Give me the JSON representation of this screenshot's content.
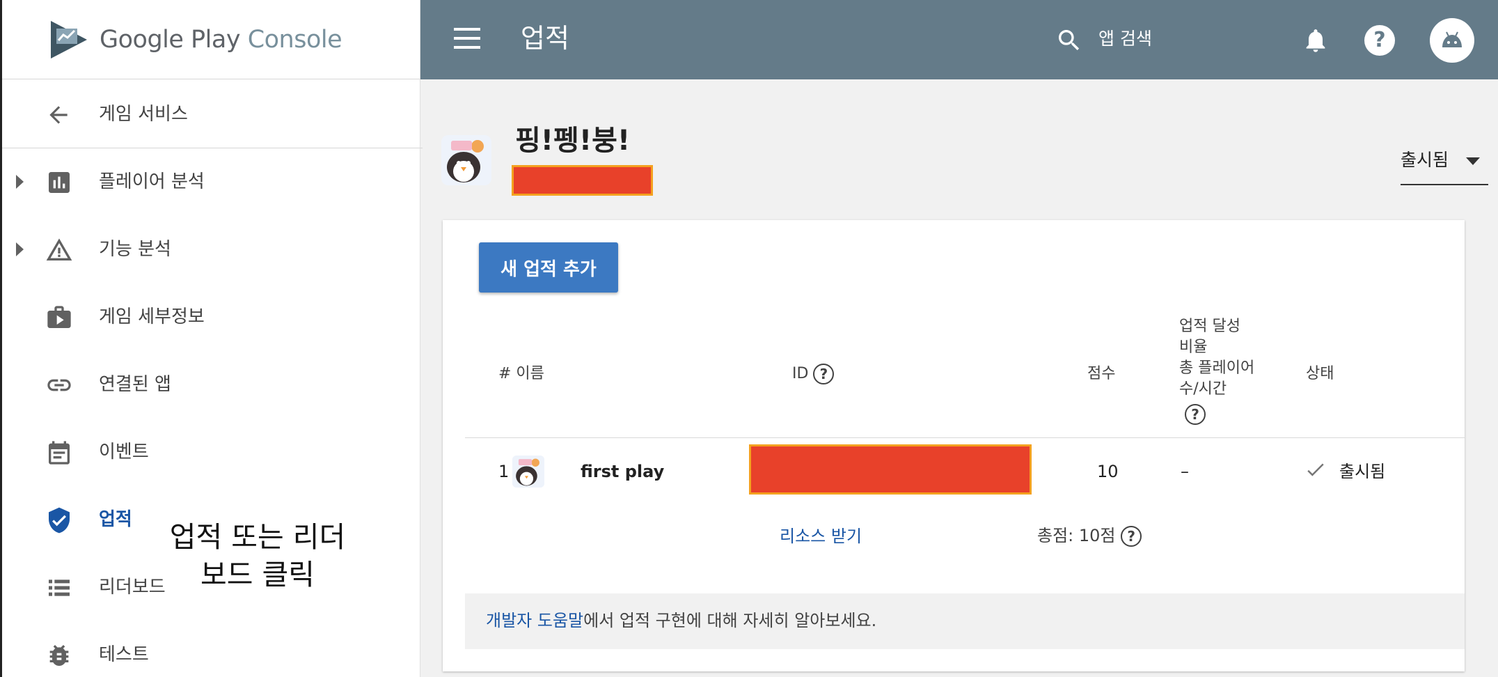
{
  "app": {
    "brand_google_play": "Google Play",
    "brand_console": "Console"
  },
  "sidebar": {
    "back_label": "게임 서비스",
    "items": [
      {
        "label": "플레이어 분석",
        "icon": "bar-chart-icon",
        "expandable": true
      },
      {
        "label": "기능 분석",
        "icon": "warning-triangle-icon",
        "expandable": true
      },
      {
        "label": "게임 세부정보",
        "icon": "briefcase-play-icon",
        "expandable": false
      },
      {
        "label": "연결된 앱",
        "icon": "link-icon",
        "expandable": false
      },
      {
        "label": "이벤트",
        "icon": "calendar-icon",
        "expandable": false
      },
      {
        "label": "업적",
        "icon": "shield-check-icon",
        "expandable": false,
        "active": true
      },
      {
        "label": "리더보드",
        "icon": "list-icon",
        "expandable": false
      },
      {
        "label": "테스트",
        "icon": "bug-icon",
        "expandable": false
      }
    ]
  },
  "annotation": {
    "line1": "업적 또는 리더",
    "line2": "보드 클릭"
  },
  "topbar": {
    "title": "업적",
    "search_placeholder": "앱 검색",
    "help_glyph": "?"
  },
  "game": {
    "title": "핑!펭!붕!",
    "status_filter": "출시됨"
  },
  "achievements": {
    "add_button": "새 업적 추가",
    "columns": {
      "name": "# 이름",
      "id": "ID",
      "points": "점수",
      "rate_line1": "업적 달성",
      "rate_line2": "비율",
      "rate_line3": "총 플레이어",
      "rate_line4": "수/시간",
      "status": "상태"
    },
    "rows": [
      {
        "index": "1",
        "name": "first play",
        "points": "10",
        "rate": "–",
        "status": "출시됨"
      }
    ],
    "resource_link": "리소스 받기",
    "total": "총점: 10점",
    "footer_link": "개발자 도움말",
    "footer_text": "에서 업적 구현에 대해 자세히 알아보세요."
  },
  "colors": {
    "topbar": "#647b89",
    "primary_button": "#3c79c2",
    "link": "#1a56a5",
    "redaction": "#e8412a",
    "redaction_border": "#f4a11f"
  }
}
